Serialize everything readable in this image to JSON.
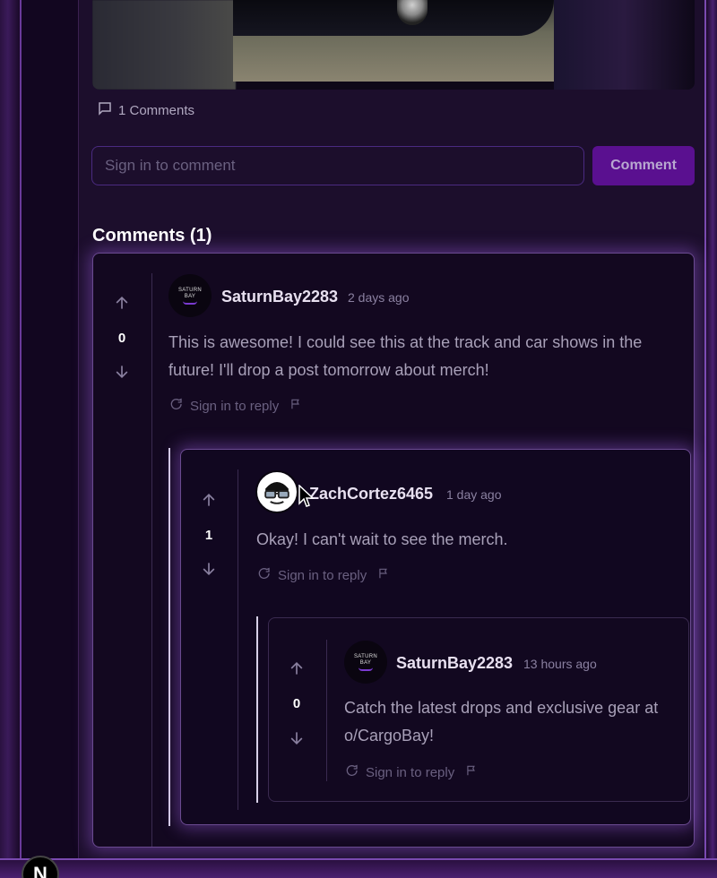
{
  "post": {
    "comments_count_label": "1 Comments"
  },
  "comment_box": {
    "placeholder": "Sign in to comment",
    "button_label": "Comment"
  },
  "comments_heading": "Comments (1)",
  "comments": [
    {
      "username": "SaturnBay2283",
      "avatar_text": "SATURN BAY",
      "timestamp": "2 days ago",
      "votes": "0",
      "text": "This is awesome! I could see this at the track and car shows in the future! I'll drop a post tomorrow about merch!",
      "reply_label": "Sign in to reply"
    },
    {
      "username": "ZachCortez6465",
      "timestamp": "1 day ago",
      "votes": "1",
      "text": "Okay! I can't wait to see the merch.",
      "reply_label": "Sign in to reply"
    },
    {
      "username": "SaturnBay2283",
      "avatar_text": "SATURN BAY",
      "timestamp": "13 hours ago",
      "votes": "0",
      "text": "Catch the latest drops and exclusive gear at o/CargoBay!",
      "reply_label": "Sign in to reply"
    }
  ],
  "badge": "N",
  "colors": {
    "accent": "#5a1090",
    "card_glow": "#9a5adc",
    "background": "#1c0e2c"
  }
}
